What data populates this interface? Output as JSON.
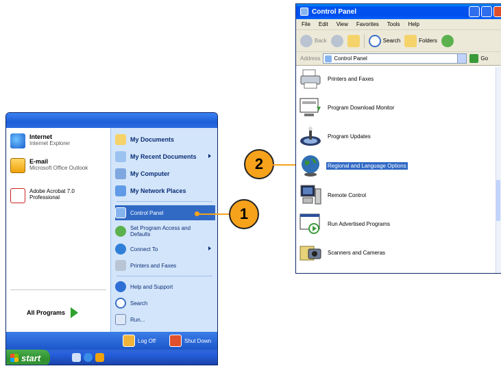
{
  "start_menu": {
    "pinned": [
      {
        "title": "Internet",
        "subtitle": "Internet Explorer"
      },
      {
        "title": "E-mail",
        "subtitle": "Microsoft Office Outlook"
      },
      {
        "title": "Adobe Acrobat 7.0",
        "subtitle": "Professional"
      }
    ],
    "all_programs": "All Programs",
    "right_items": [
      {
        "label": "My Documents"
      },
      {
        "label": "My Recent Documents"
      },
      {
        "label": "My Computer"
      },
      {
        "label": "My Network Places"
      },
      {
        "label": "Control Panel"
      },
      {
        "label": "Set Program Access and Defaults"
      },
      {
        "label": "Connect To"
      },
      {
        "label": "Printers and Faxes"
      },
      {
        "label": "Help and Support"
      },
      {
        "label": "Search"
      },
      {
        "label": "Run..."
      }
    ],
    "log_off": "Log Off",
    "shut_down": "Shut Down"
  },
  "taskbar": {
    "start_label": "start"
  },
  "callouts": {
    "one": "1",
    "two": "2"
  },
  "control_panel": {
    "title": "Control Panel",
    "menu": [
      "File",
      "Edit",
      "View",
      "Favorites",
      "Tools",
      "Help"
    ],
    "toolbar": {
      "back": "Back",
      "search": "Search",
      "folders": "Folders"
    },
    "address_label": "Address",
    "address_value": "Control Panel",
    "go_label": "Go",
    "items": [
      {
        "label": "Printers and Faxes"
      },
      {
        "label": "Program Download Monitor"
      },
      {
        "label": "Program Updates"
      },
      {
        "label": "Regional and Language Options"
      },
      {
        "label": "Remote Control"
      },
      {
        "label": "Run Advertised Programs"
      },
      {
        "label": "Scanners and Cameras"
      }
    ]
  },
  "colors": {
    "callout": "#f7a21b",
    "selection": "#316ac5",
    "xp_blue": "#0050ee"
  }
}
